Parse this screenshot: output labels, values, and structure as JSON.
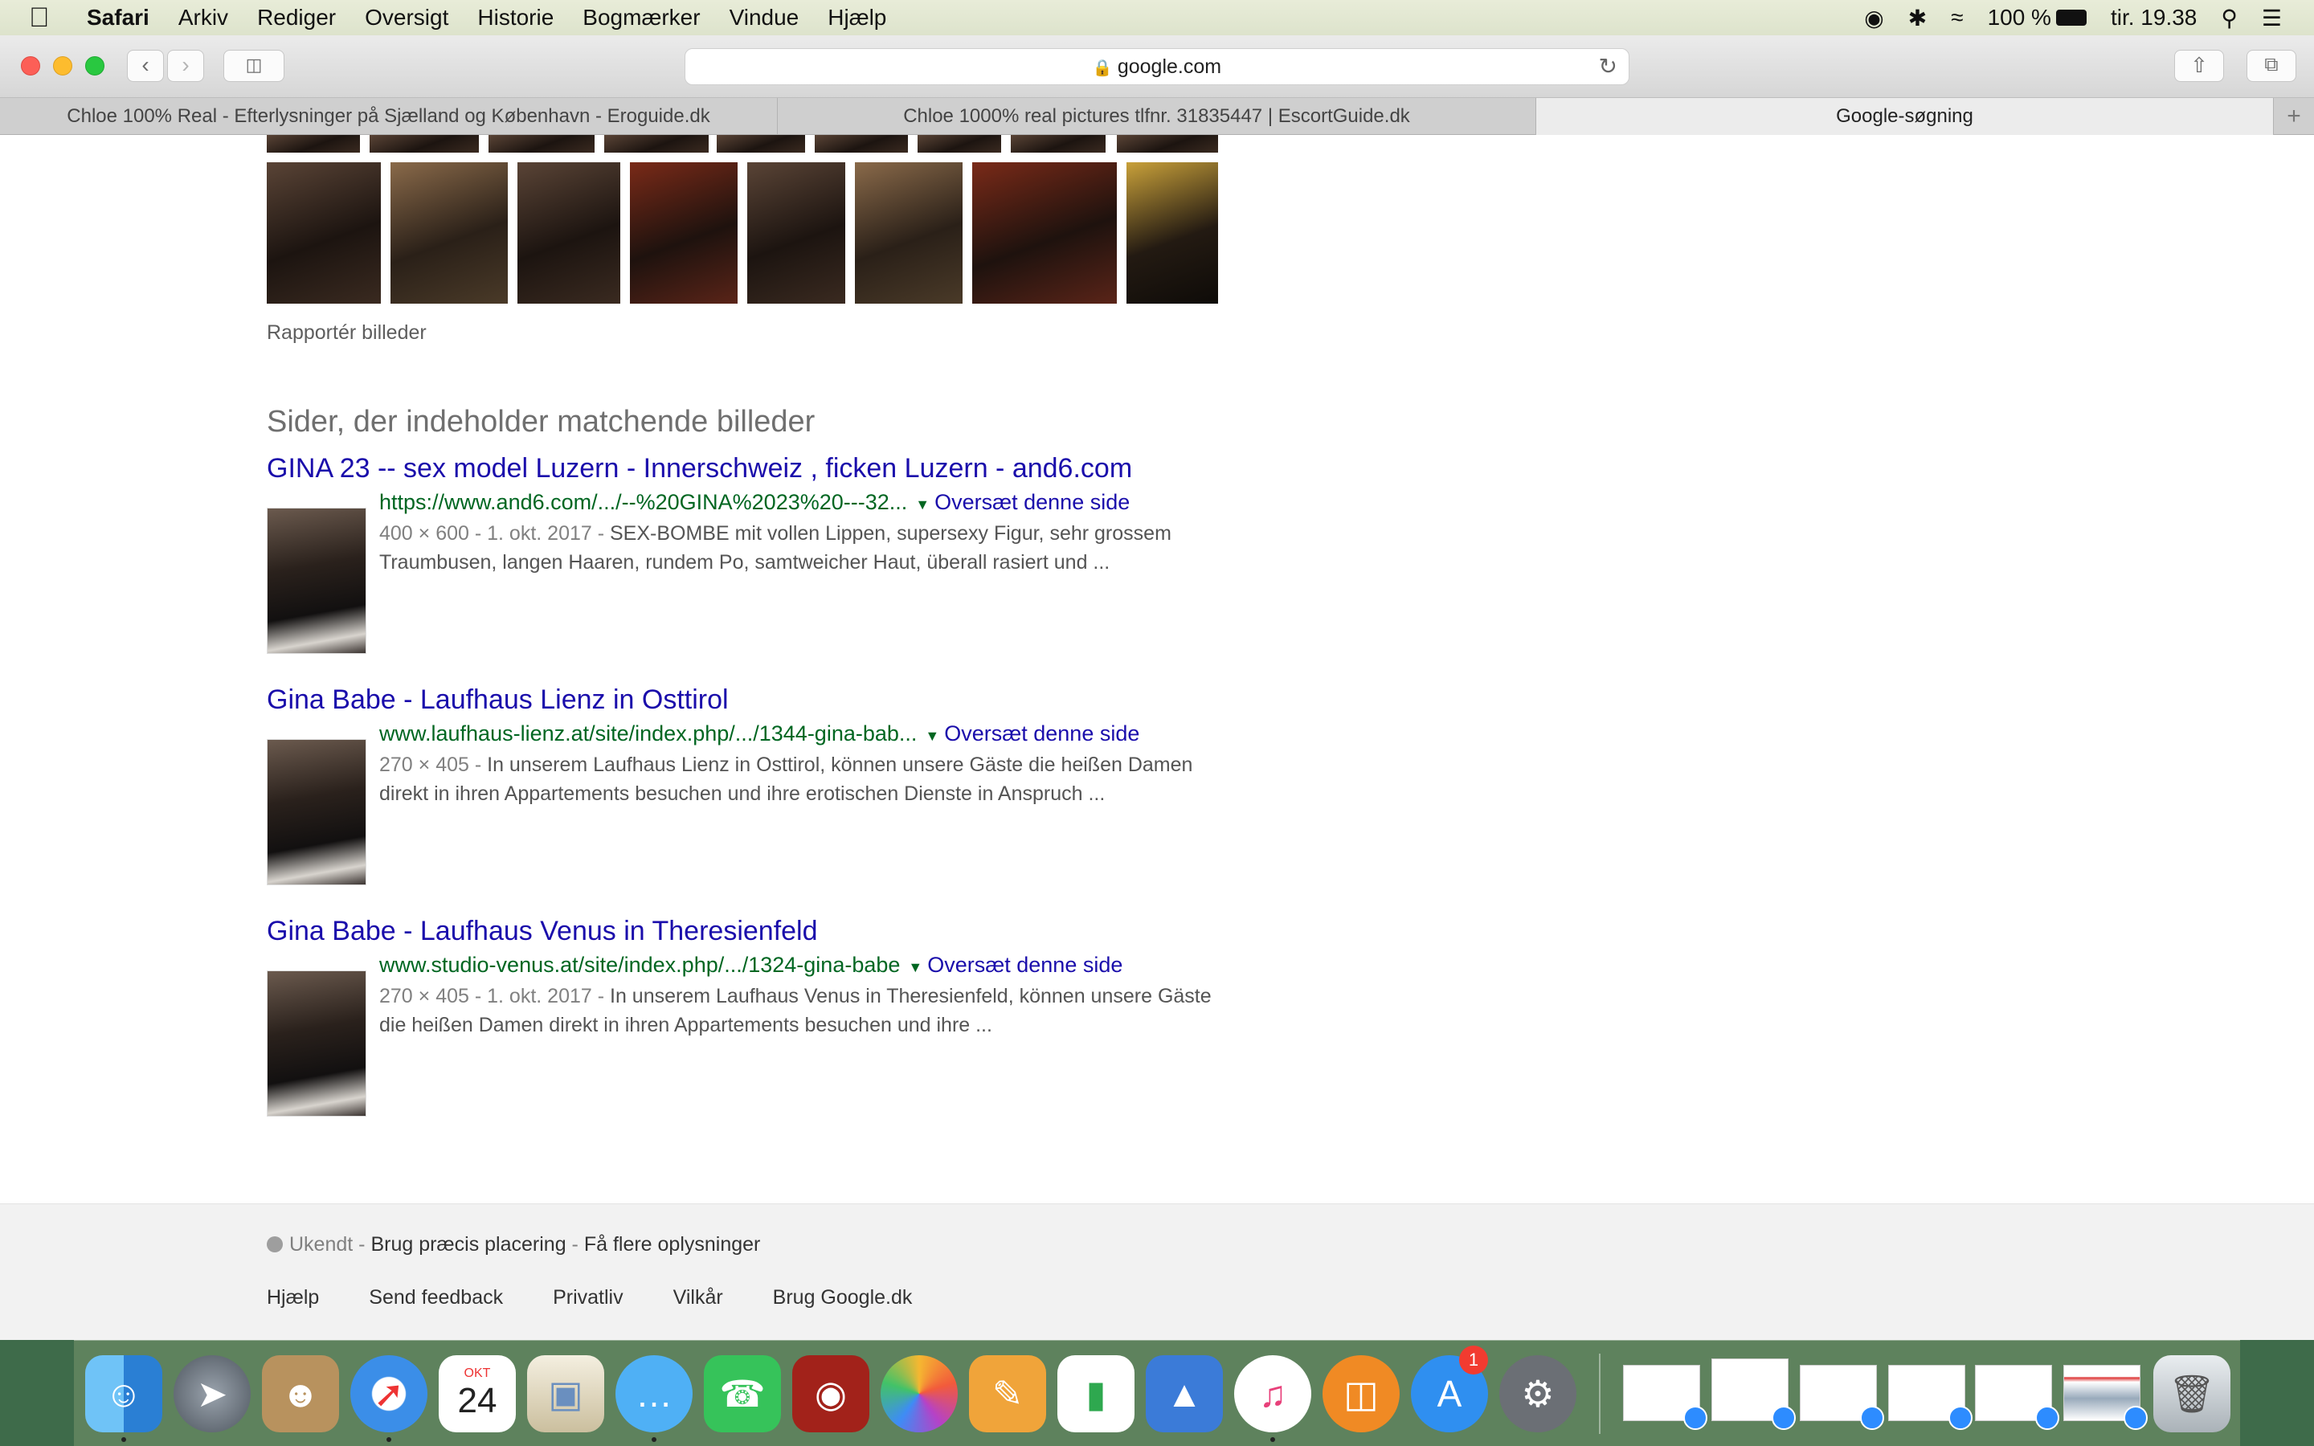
{
  "menubar": {
    "app": "Safari",
    "items": [
      "Arkiv",
      "Rediger",
      "Oversigt",
      "Historie",
      "Bogmærker",
      "Vindue",
      "Hjælp"
    ],
    "battery": "100 %",
    "clock": "tir. 19.38"
  },
  "browser": {
    "url": "google.com",
    "tabs": [
      "Chloe 100% Real - Efterlysninger på Sjælland og København - Eroguide.dk",
      "Chloe 1000% real pictures tlfnr. 31835447 | EscortGuide.dk",
      "Google-søgning"
    ],
    "active_tab": 2
  },
  "page": {
    "report_images": "Rapportér billeder",
    "section_title": "Sider, der indeholder matchende billeder",
    "results": [
      {
        "title": "GINA 23 -- sex model Luzern - Innerschweiz , ficken Luzern - and6.com",
        "url": "https://www.and6.com/.../--%20GINA%2023%20---32...",
        "translate": "Oversæt denne side",
        "meta": "400 × 600 - 1. okt. 2017 - ",
        "line1": "SEX-BOMBE mit vollen Lippen, supersexy Figur, sehr grossem",
        "line2": "Traumbusen, langen Haaren, rundem Po, samtweicher Haut, überall rasiert und ..."
      },
      {
        "title": "Gina Babe - Laufhaus Lienz in Osttirol",
        "url": "www.laufhaus-lienz.at/site/index.php/.../1344-gina-bab...",
        "translate": "Oversæt denne side",
        "meta": "270 × 405 - ",
        "line1": "In unserem Laufhaus Lienz in Osttirol, können unsere Gäste die heißen Damen",
        "line2": "direkt in ihren Appartements besuchen und ihre erotischen Dienste in Anspruch ..."
      },
      {
        "title": "Gina Babe - Laufhaus Venus in Theresienfeld",
        "url": "www.studio-venus.at/site/index.php/.../1324-gina-babe",
        "translate": "Oversæt denne side",
        "meta": "270 × 405 - 1. okt. 2017 - ",
        "line1": "In unserem Laufhaus Venus in Theresienfeld, können unsere Gäste",
        "line2": "die heißen Damen direkt in ihren Appartements besuchen und ihre ..."
      }
    ]
  },
  "footer": {
    "location_status": "Ukendt",
    "precise_location": "Brug præcis placering",
    "more_info": "Få flere oplysninger",
    "links": [
      "Hjælp",
      "Send feedback",
      "Privatliv",
      "Vilkår",
      "Brug Google.dk"
    ]
  },
  "dock": {
    "calendar_month": "OKT",
    "calendar_day": "24",
    "appstore_badge": "1",
    "icons": [
      "finder-icon",
      "launchpad-icon",
      "contacts-icon",
      "safari-icon",
      "calendar-icon",
      "preview-icon",
      "messages-icon",
      "facetime-icon",
      "photo-booth-icon",
      "photos-icon",
      "pages-icon",
      "numbers-icon",
      "keynote-icon",
      "itunes-icon",
      "ibooks-icon",
      "app-store-icon",
      "system-preferences-icon",
      "trash-icon"
    ]
  }
}
